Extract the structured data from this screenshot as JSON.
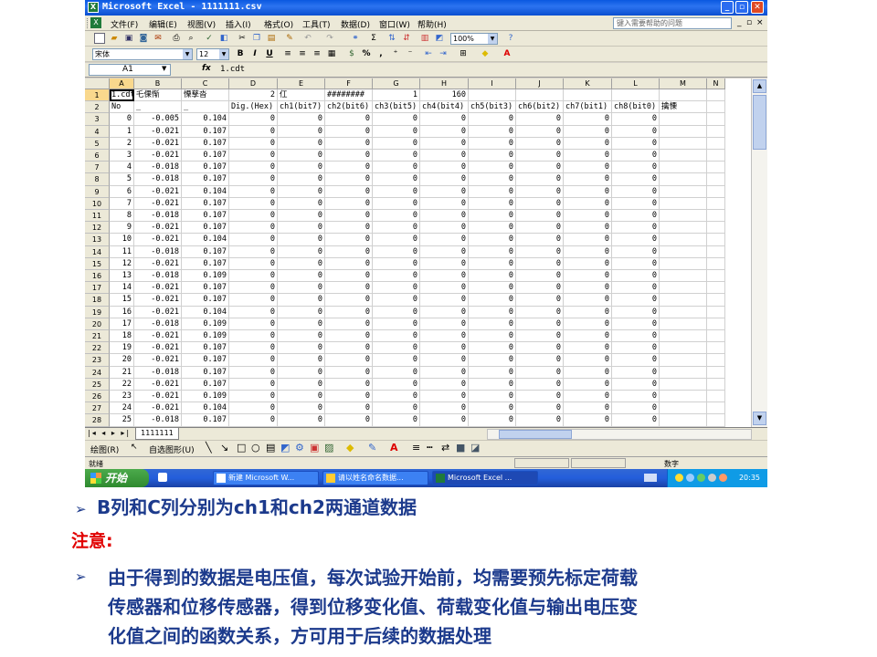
{
  "window": {
    "title": "Microsoft Excel - 1111111.csv",
    "help_placeholder": "键入需要帮助的问题",
    "min": "_",
    "max": "▫",
    "close": "✕"
  },
  "menu": [
    "文件(F)",
    "编辑(E)",
    "视图(V)",
    "插入(I)",
    "格式(O)",
    "工具(T)",
    "数据(D)",
    "窗口(W)",
    "帮助(H)"
  ],
  "toolbar": {
    "zoom": "100%",
    "font": "宋体",
    "size": "12"
  },
  "formula": {
    "cell_ref": "A1",
    "fx": "fx",
    "value": "1.cdt"
  },
  "columns": [
    "A",
    "B",
    "C",
    "D",
    "E",
    "F",
    "G",
    "H",
    "I",
    "J",
    "K",
    "L",
    "M",
    "N"
  ],
  "row1": [
    "1.cdt",
    "乇倮惭",
    "慄孳沓",
    "2",
    "仜",
    "########",
    "1",
    "160",
    "",
    "",
    "",
    "",
    "",
    ""
  ],
  "row2": [
    "No",
    "_",
    "_",
    "Dig.(Hex)",
    "ch1(bit7)",
    "ch2(bit6)",
    "ch3(bit5)",
    "ch4(bit4)",
    "ch5(bit3)",
    "ch6(bit2)",
    "ch7(bit1)",
    "ch8(bit0)",
    "擒慄",
    ""
  ],
  "data_rows": [
    [
      "0",
      "-0.005",
      "0.104"
    ],
    [
      "1",
      "-0.021",
      "0.107"
    ],
    [
      "2",
      "-0.021",
      "0.107"
    ],
    [
      "3",
      "-0.021",
      "0.107"
    ],
    [
      "4",
      "-0.018",
      "0.107"
    ],
    [
      "5",
      "-0.018",
      "0.107"
    ],
    [
      "6",
      "-0.021",
      "0.104"
    ],
    [
      "7",
      "-0.021",
      "0.107"
    ],
    [
      "8",
      "-0.018",
      "0.107"
    ],
    [
      "9",
      "-0.021",
      "0.107"
    ],
    [
      "10",
      "-0.021",
      "0.104"
    ],
    [
      "11",
      "-0.018",
      "0.107"
    ],
    [
      "12",
      "-0.021",
      "0.107"
    ],
    [
      "13",
      "-0.018",
      "0.109"
    ],
    [
      "14",
      "-0.021",
      "0.107"
    ],
    [
      "15",
      "-0.021",
      "0.107"
    ],
    [
      "16",
      "-0.021",
      "0.104"
    ],
    [
      "17",
      "-0.018",
      "0.109"
    ],
    [
      "18",
      "-0.021",
      "0.109"
    ],
    [
      "19",
      "-0.021",
      "0.107"
    ],
    [
      "20",
      "-0.021",
      "0.107"
    ],
    [
      "21",
      "-0.018",
      "0.107"
    ],
    [
      "22",
      "-0.021",
      "0.107"
    ],
    [
      "23",
      "-0.021",
      "0.109"
    ],
    [
      "24",
      "-0.021",
      "0.104"
    ],
    [
      "25",
      "-0.018",
      "0.107"
    ]
  ],
  "zero_value": "0",
  "sheet_tab": "1111111",
  "drawbar": {
    "draw": "绘图(R)",
    "autoshape": "自选图形(U)"
  },
  "status": {
    "ready": "就绪",
    "num": "数字"
  },
  "taskbar": {
    "start": "开始",
    "tasks": [
      "新建 Microsoft W...",
      "请以姓名命名数据...",
      "Microsoft Excel ..."
    ],
    "clock": "20:35"
  },
  "slide": {
    "bullet1": "B列和C列分别为ch1和ch2两通道数据",
    "note": "注意:",
    "bullet2_lines": [
      "由于得到的数据是电压值，每次试验开始前，均需要预先标定荷载",
      "传感器和位移传感器，得到位移变化值、荷载变化值与输出电压变",
      "化值之间的函数关系，方可用于后续的数据处理"
    ],
    "arrow": "➢"
  }
}
